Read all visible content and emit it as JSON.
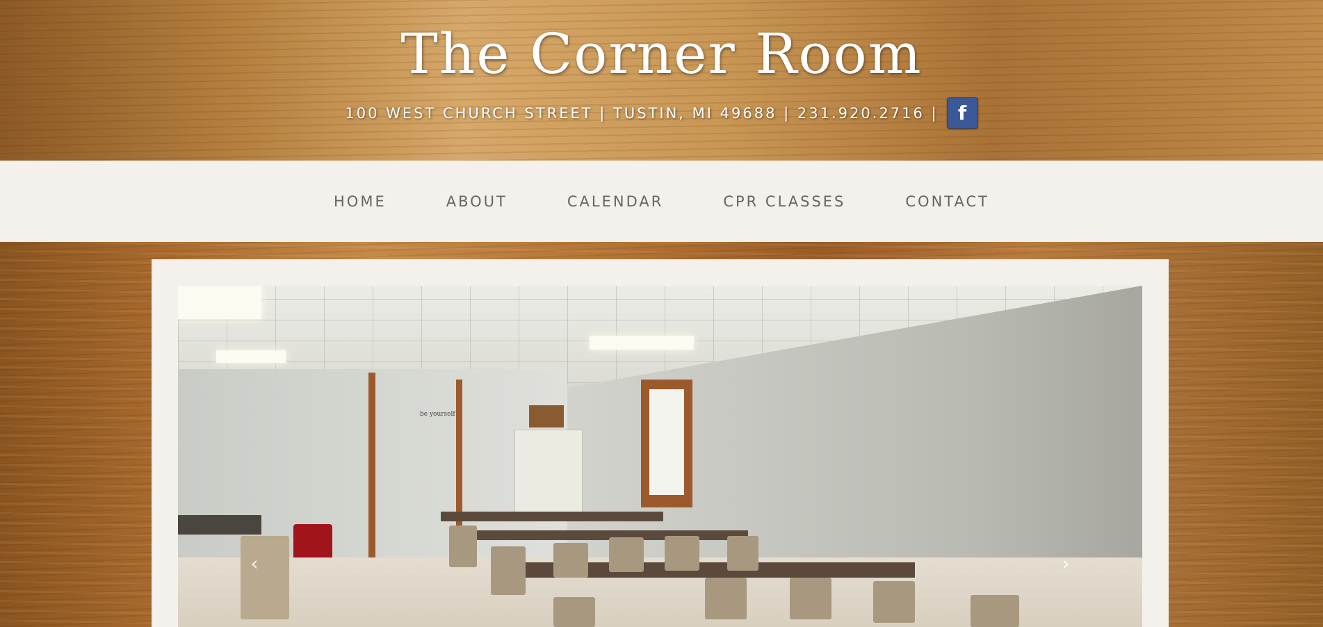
{
  "header": {
    "title": "The Corner Room",
    "address_line": "100 WEST CHURCH STREET | TUSTIN, MI 49688 | 231.920.2716 |",
    "facebook_icon": "facebook-icon",
    "facebook_label": "f"
  },
  "nav": {
    "items": [
      {
        "label": "HOME"
      },
      {
        "label": "ABOUT"
      },
      {
        "label": "CALENDAR"
      },
      {
        "label": "CPR CLASSES"
      },
      {
        "label": "CONTACT"
      }
    ]
  },
  "slider": {
    "prev_label": "‹",
    "next_label": "›",
    "wall_decal": "be yourself"
  },
  "colors": {
    "nav_background": "#f4f0ec",
    "nav_text": "#666666",
    "facebook_blue": "#3b5998",
    "title_text": "#ffffff"
  }
}
